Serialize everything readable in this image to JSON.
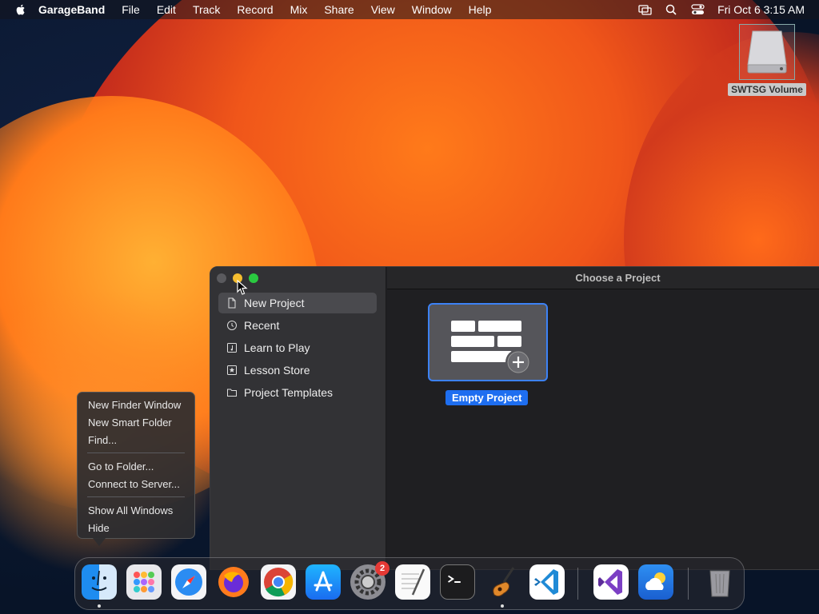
{
  "menubar": {
    "app_name": "GarageBand",
    "menus": [
      "File",
      "Edit",
      "Track",
      "Record",
      "Mix",
      "Share",
      "View",
      "Window",
      "Help"
    ],
    "clock": "Fri Oct 6  3:15 AM"
  },
  "desktop": {
    "volume_label": "SWTSG Volume"
  },
  "window": {
    "title": "Choose a Project",
    "sidebar": [
      {
        "label": "New Project",
        "icon": "document-icon",
        "selected": true
      },
      {
        "label": "Recent",
        "icon": "clock-icon",
        "selected": false
      },
      {
        "label": "Learn to Play",
        "icon": "music-note-icon",
        "selected": false
      },
      {
        "label": "Lesson Store",
        "icon": "star-icon",
        "selected": false
      },
      {
        "label": "Project Templates",
        "icon": "folder-icon",
        "selected": false
      }
    ],
    "project": {
      "label": "Empty Project"
    }
  },
  "context_menu": {
    "items": [
      "New Finder Window",
      "New Smart Folder",
      "Find...",
      "Go to Folder...",
      "Connect to Server...",
      "Show All Windows",
      "Hide"
    ]
  },
  "dock": {
    "apps": [
      {
        "name": "finder",
        "running": true
      },
      {
        "name": "launchpad"
      },
      {
        "name": "safari"
      },
      {
        "name": "firefox"
      },
      {
        "name": "chrome"
      },
      {
        "name": "app-store"
      },
      {
        "name": "system-settings",
        "badge": "2"
      },
      {
        "name": "textedit"
      },
      {
        "name": "terminal"
      },
      {
        "name": "garageband",
        "running": true
      },
      {
        "name": "vscode"
      },
      {
        "name": "visual-studio"
      },
      {
        "name": "weather"
      },
      {
        "name": "trash"
      }
    ]
  },
  "colors": {
    "accent": "#1e6ef0",
    "minimize": "#f5bd2f",
    "maximize": "#2ac940"
  }
}
